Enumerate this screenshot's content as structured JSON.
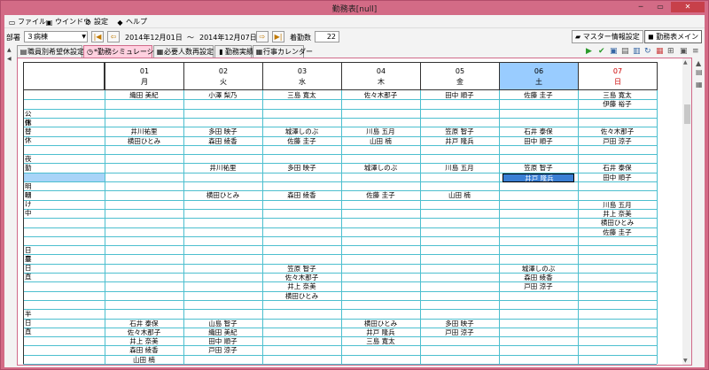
{
  "window": {
    "title": "勤務表[null]",
    "minimize": "─",
    "maximize": "▭",
    "close": "✕"
  },
  "menu": [
    {
      "label": "ファイル",
      "icon": "folder-icon"
    },
    {
      "label": "ウインドウ",
      "icon": "window-icon"
    },
    {
      "label": "設定",
      "icon": "gear-icon"
    },
    {
      "label": "ヘルプ",
      "icon": "help-icon"
    }
  ],
  "toolbar": {
    "dept_label": "部署",
    "dept_value": "３病棟",
    "date_from": "2014年12月01日",
    "tilde": "～",
    "date_to": "2014年12月07日",
    "duty_label": "着勤数",
    "duty_count": "22",
    "master_btn": "マスター情報設定",
    "main_btn": "勤務表メイン"
  },
  "tabs": [
    {
      "label": "職員別希望休設定",
      "icon": "page-icon",
      "active": false
    },
    {
      "label": "*勤務シミュレーション",
      "icon": "clock-icon",
      "active": true
    },
    {
      "label": "必要人数再設定",
      "icon": "people-icon",
      "active": false
    },
    {
      "label": "勤務実績",
      "icon": "chart-icon",
      "active": false
    },
    {
      "label": "行事カレンダー",
      "icon": "calendar-icon",
      "active": false
    }
  ],
  "days": [
    {
      "num": "01",
      "dow": "月",
      "highlight": false,
      "red": false
    },
    {
      "num": "02",
      "dow": "火",
      "highlight": false,
      "red": false
    },
    {
      "num": "03",
      "dow": "水",
      "highlight": false,
      "red": false
    },
    {
      "num": "04",
      "dow": "木",
      "highlight": false,
      "red": false
    },
    {
      "num": "05",
      "dow": "金",
      "highlight": false,
      "red": false
    },
    {
      "num": "06",
      "dow": "土",
      "highlight": true,
      "red": false
    },
    {
      "num": "07",
      "dow": "日",
      "highlight": false,
      "red": true
    }
  ],
  "rowLabels": [
    {
      "text": "公休",
      "row": 2
    },
    {
      "text": "振替休",
      "row": 3
    },
    {
      "text": "夜勤",
      "row": 7
    },
    {
      "text": "明け",
      "row": 10
    },
    {
      "text": "明け中",
      "row": 11
    },
    {
      "text": "日直",
      "row": 17
    },
    {
      "text": "早日直",
      "row": 18
    },
    {
      "text": "半日直",
      "row": 24
    }
  ],
  "highlightRow": 9,
  "names": [
    {
      "row": 0,
      "col": 0,
      "text": "織田 美紀"
    },
    {
      "row": 0,
      "col": 1,
      "text": "小澤 梨乃"
    },
    {
      "row": 0,
      "col": 2,
      "text": "三島 寛太"
    },
    {
      "row": 0,
      "col": 3,
      "text": "佐々木那子"
    },
    {
      "row": 0,
      "col": 4,
      "text": "田中 順子"
    },
    {
      "row": 0,
      "col": 5,
      "text": "佐藤 圭子"
    },
    {
      "row": 0,
      "col": 6,
      "text": "三島 寛太"
    },
    {
      "row": 1,
      "col": 6,
      "text": "伊藤 裕子"
    },
    {
      "row": 4,
      "col": 0,
      "text": "井川祐里"
    },
    {
      "row": 4,
      "col": 1,
      "text": "多田 映子"
    },
    {
      "row": 4,
      "col": 2,
      "text": "城澤しのぶ"
    },
    {
      "row": 4,
      "col": 3,
      "text": "川島 五月"
    },
    {
      "row": 4,
      "col": 4,
      "text": "笠原 智子"
    },
    {
      "row": 4,
      "col": 5,
      "text": "石井 泰保"
    },
    {
      "row": 4,
      "col": 6,
      "text": "佐々木那子"
    },
    {
      "row": 5,
      "col": 0,
      "text": "横田ひとみ"
    },
    {
      "row": 5,
      "col": 1,
      "text": "森田 綾香"
    },
    {
      "row": 5,
      "col": 2,
      "text": "佐藤 圭子"
    },
    {
      "row": 5,
      "col": 3,
      "text": "山田 楠"
    },
    {
      "row": 5,
      "col": 4,
      "text": "井戸 隆兵"
    },
    {
      "row": 5,
      "col": 5,
      "text": "田中 順子"
    },
    {
      "row": 5,
      "col": 6,
      "text": "戸田 涼子"
    },
    {
      "row": 8,
      "col": 1,
      "text": "井川祐里"
    },
    {
      "row": 8,
      "col": 2,
      "text": "多田 映子"
    },
    {
      "row": 8,
      "col": 3,
      "text": "城澤しのぶ"
    },
    {
      "row": 8,
      "col": 4,
      "text": "川島 五月"
    },
    {
      "row": 8,
      "col": 5,
      "text": "笠原 智子"
    },
    {
      "row": 8,
      "col": 6,
      "text": "石井 泰保"
    },
    {
      "row": 9,
      "col": 5,
      "text": "井戸 隆兵",
      "selected": true
    },
    {
      "row": 9,
      "col": 6,
      "text": "田中 順子"
    },
    {
      "row": 11,
      "col": 1,
      "text": "横田ひとみ"
    },
    {
      "row": 11,
      "col": 2,
      "text": "森田 綾香"
    },
    {
      "row": 11,
      "col": 3,
      "text": "佐藤 圭子"
    },
    {
      "row": 11,
      "col": 4,
      "text": "山田 楠"
    },
    {
      "row": 12,
      "col": 6,
      "text": "川島 五月"
    },
    {
      "row": 13,
      "col": 6,
      "text": "井上 奈美"
    },
    {
      "row": 14,
      "col": 6,
      "text": "横田ひとみ"
    },
    {
      "row": 15,
      "col": 6,
      "text": "佐藤 圭子"
    },
    {
      "row": 19,
      "col": 2,
      "text": "笠原 智子"
    },
    {
      "row": 19,
      "col": 5,
      "text": "城澤しのぶ"
    },
    {
      "row": 20,
      "col": 2,
      "text": "佐々木那子"
    },
    {
      "row": 20,
      "col": 5,
      "text": "森田 綾香"
    },
    {
      "row": 21,
      "col": 2,
      "text": "井上 奈美"
    },
    {
      "row": 21,
      "col": 5,
      "text": "戸田 涼子"
    },
    {
      "row": 22,
      "col": 2,
      "text": "横田ひとみ"
    },
    {
      "row": 25,
      "col": 0,
      "text": "石井 泰保"
    },
    {
      "row": 25,
      "col": 1,
      "text": "山島 智子"
    },
    {
      "row": 25,
      "col": 3,
      "text": "横田ひとみ"
    },
    {
      "row": 25,
      "col": 4,
      "text": "多田 映子"
    },
    {
      "row": 26,
      "col": 0,
      "text": "佐々木那子"
    },
    {
      "row": 26,
      "col": 1,
      "text": "織田 美紀"
    },
    {
      "row": 26,
      "col": 3,
      "text": "井戸 隆兵"
    },
    {
      "row": 26,
      "col": 4,
      "text": "戸田 涼子"
    },
    {
      "row": 27,
      "col": 0,
      "text": "井上 奈美"
    },
    {
      "row": 27,
      "col": 1,
      "text": "田中 順子"
    },
    {
      "row": 27,
      "col": 3,
      "text": "三島 寛太"
    },
    {
      "row": 28,
      "col": 0,
      "text": "森田 綾香"
    },
    {
      "row": 28,
      "col": 1,
      "text": "戸田 涼子"
    },
    {
      "row": 29,
      "col": 0,
      "text": "山田 楠"
    }
  ]
}
